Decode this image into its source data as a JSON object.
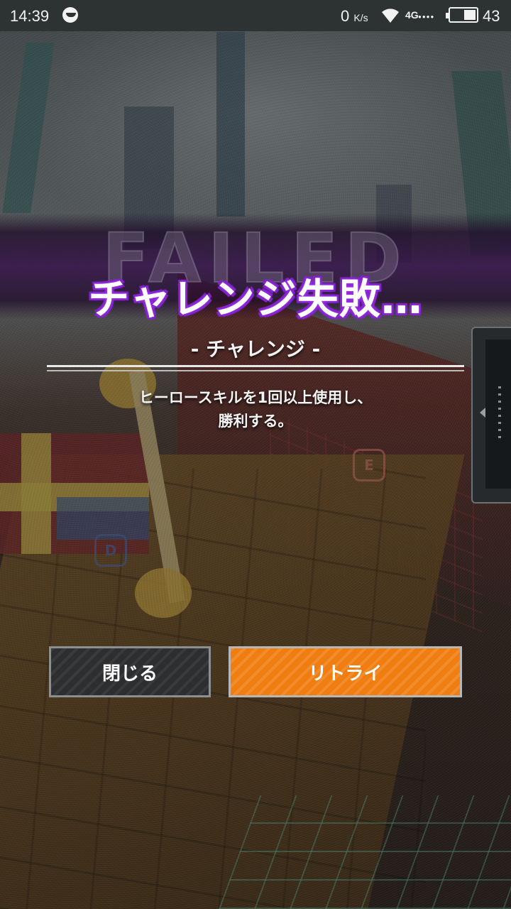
{
  "status_bar": {
    "time": "14:39",
    "net_speed": "0",
    "net_unit": "K/s",
    "network": "4G",
    "battery_percent": "43",
    "battery_level": 0.43
  },
  "background": {
    "word": "FAILED",
    "hex_e": "E",
    "hex_d": "D"
  },
  "dialog": {
    "title": "チャレンジ失敗…",
    "subtitle": "- チャレンジ -",
    "description_line1": "ヒーロースキルを1回以上使用し、",
    "description_line2": "勝利する。",
    "close_label": "閉じる",
    "retry_label": "リトライ"
  },
  "colors": {
    "title_glow": "#b23bff",
    "retry_button": "#f07d10",
    "close_button": "#2c2e2f"
  }
}
